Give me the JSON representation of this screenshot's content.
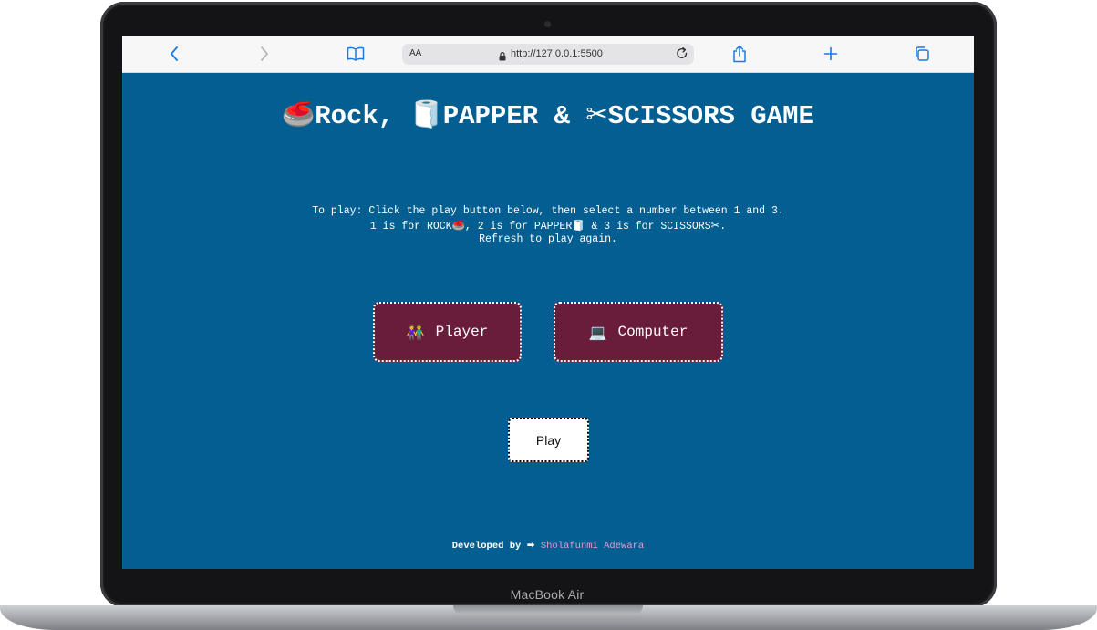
{
  "device": {
    "label": "MacBook Air"
  },
  "browser": {
    "reader_label": "AA",
    "url": "http://127.0.0.1:5500",
    "accent": "#1a7ae0"
  },
  "page": {
    "background": "#035f91",
    "title": {
      "rock_icon": "🥌",
      "rock_text": "Rock,",
      "paper_icon": "🧻",
      "paper_text": "PAPPER &",
      "scissors_icon": "✂",
      "scissors_text": "SCISSORS GAME"
    },
    "instructions": {
      "line1": "To play: Click the play button below, then select a number between 1 and 3.",
      "line2_a": "1 is for ROCK",
      "line2_rock_icon": "🥌",
      "line2_b": ", 2 is for PAPPER",
      "line2_paper_icon": "🧻",
      "line2_c": " & 3 is for SCISSORS",
      "line2_scissors_icon": "✂",
      "line2_d": ".",
      "line3": "Refresh to play again."
    },
    "player_button": {
      "icon": "👫",
      "label": "Player"
    },
    "computer_button": {
      "icon": "💻",
      "label": "Computer"
    },
    "play_button": {
      "label": "Play"
    },
    "footer": {
      "prefix": "Developed by",
      "arrow": "➡",
      "author": "Sholafunmi Adewara"
    }
  }
}
